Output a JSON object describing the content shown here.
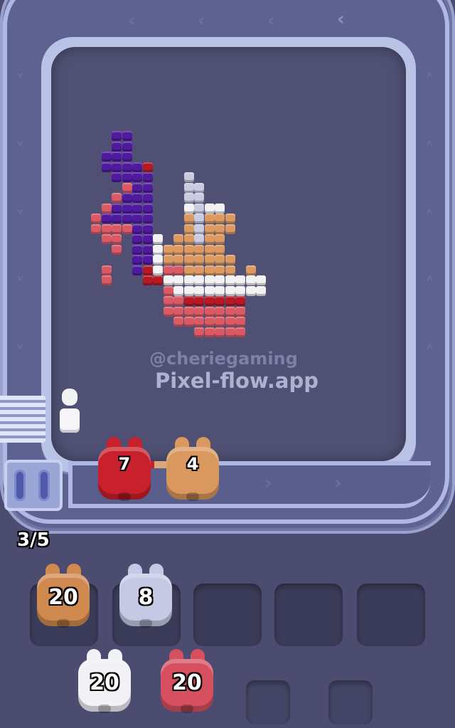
{
  "watermark": {
    "handle": "@cheriegaming",
    "site": "Pixel-flow.app"
  },
  "counter": "3/5",
  "active_shooters": [
    {
      "id": "red",
      "count": "7",
      "color": "#c8202c"
    },
    {
      "id": "tan",
      "count": "4",
      "color": "#d9985e"
    }
  ],
  "queue_shooters": [
    {
      "id": "tan",
      "count": "20",
      "color": "#d08a50"
    },
    {
      "id": "lavender",
      "count": "8",
      "color": "#c6c9e4"
    },
    {
      "id": "white",
      "count": "20",
      "color": "#f1f1f6"
    },
    {
      "id": "pink",
      "count": "20",
      "color": "#d65060"
    }
  ],
  "colors": {
    "purple": "#4f1a9e",
    "pink": "#d95a64",
    "red": "#b51a24",
    "tan": "#dc9a62",
    "white": "#f2f2f4",
    "lavender": "#c9cbe0"
  }
}
